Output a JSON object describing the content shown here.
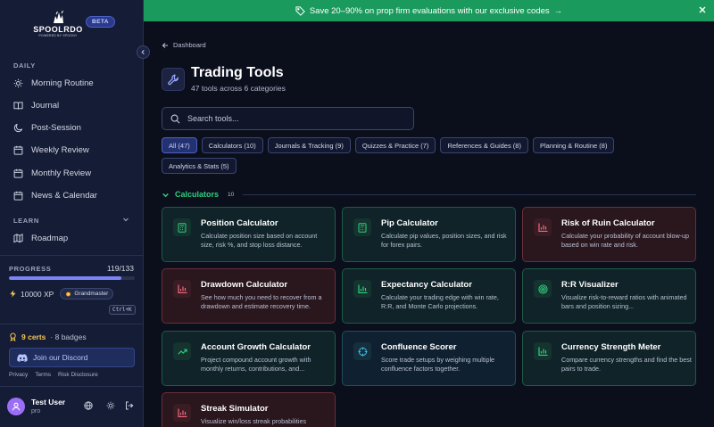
{
  "sidebar": {
    "logo_text": "SPOOLRDO",
    "logo_tagline": "POWERED BY SPOONY",
    "beta": "BETA",
    "daily_label": "DAILY",
    "daily_items": [
      {
        "label": "Morning Routine",
        "icon": "sun-icon"
      },
      {
        "label": "Journal",
        "icon": "book-icon"
      },
      {
        "label": "Post-Session",
        "icon": "moon-icon"
      },
      {
        "label": "Weekly Review",
        "icon": "calendar-icon"
      },
      {
        "label": "Monthly Review",
        "icon": "calendar-icon"
      },
      {
        "label": "News & Calendar",
        "icon": "calendar-icon"
      }
    ],
    "learn_label": "LEARN",
    "learn_items": [
      {
        "label": "Roadmap",
        "icon": "map-icon"
      }
    ],
    "progress": {
      "label": "PROGRESS",
      "count": "119/133",
      "fraction": 0.895
    },
    "xp": "10000 XP",
    "rank": "Grandmaster",
    "shortcut": "Ctrl+K",
    "certs": "9 certs",
    "badges": "· 8 badges",
    "discord": "Join our Discord",
    "footer_links": [
      "Privacy",
      "Terms",
      "Risk Disclosure"
    ],
    "user": {
      "name": "Test User",
      "plan": "pro"
    }
  },
  "banner": {
    "text": "Save 20–90% on prop firm evaluations with our exclusive codes",
    "arrow": "→",
    "color": "#1a9a5c"
  },
  "main": {
    "breadcrumb": "Dashboard",
    "title": "Trading Tools",
    "subtitle": "47 tools across 6 categories",
    "search_placeholder": "Search tools...",
    "filters": [
      "All (47)",
      "Calculators (10)",
      "Journals & Tracking (9)",
      "Quizzes & Practice (7)",
      "References & Guides (8)",
      "Planning & Routine (8)",
      "Analytics & Stats (5)"
    ],
    "category": {
      "name": "Calculators",
      "count": "10",
      "color": "#2fd07e"
    },
    "cards": [
      {
        "title": "Position Calculator",
        "desc": "Calculate position size based on account size, risk %, and stop loss distance.",
        "icon": "calculator-icon",
        "theme": "green"
      },
      {
        "title": "Pip Calculator",
        "desc": "Calculate pip values, position sizes, and risk for forex pairs.",
        "icon": "calculator-icon",
        "theme": "green"
      },
      {
        "title": "Risk of Ruin Calculator",
        "desc": "Calculate your probability of account blow-up based on win rate and risk.",
        "icon": "bar-chart-icon",
        "theme": "red"
      },
      {
        "title": "Drawdown Calculator",
        "desc": "See how much you need to recover from a drawdown and estimate recovery time.",
        "icon": "bar-chart-icon",
        "theme": "red"
      },
      {
        "title": "Expectancy Calculator",
        "desc": "Calculate your trading edge with win rate, R:R, and Monte Carlo projections.",
        "icon": "bar-chart-icon",
        "theme": "green"
      },
      {
        "title": "R:R Visualizer",
        "desc": "Visualize risk-to-reward ratios with animated bars and position sizing...",
        "icon": "target-icon",
        "theme": "green"
      },
      {
        "title": "Account Growth Calculator",
        "desc": "Project compound account growth with monthly returns, contributions, and...",
        "icon": "trending-up-icon",
        "theme": "green"
      },
      {
        "title": "Confluence Scorer",
        "desc": "Score trade setups by weighing multiple confluence factors together.",
        "icon": "crosshair-icon",
        "theme": "blue"
      },
      {
        "title": "Currency Strength Meter",
        "desc": "Compare currency strengths and find the best pairs to trade.",
        "icon": "bar-chart-icon",
        "theme": "green"
      },
      {
        "title": "Streak Simulator",
        "desc": "Visualize win/loss streak probabilities",
        "icon": "bar-chart-icon",
        "theme": "red"
      }
    ]
  }
}
